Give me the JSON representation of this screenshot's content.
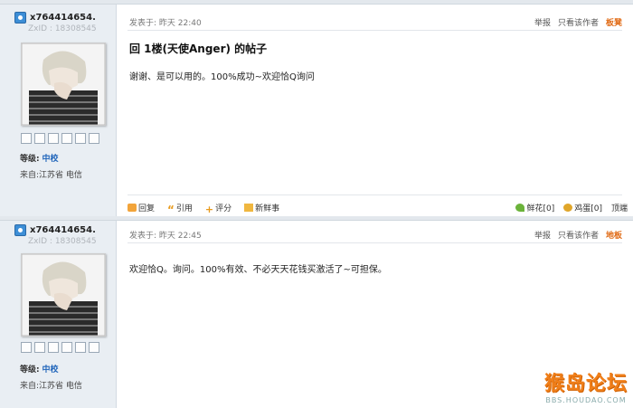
{
  "posts": [
    {
      "username": "x764414654.",
      "zxid": "ZxID : 18308545",
      "level_label": "等级:",
      "level_value": "中校",
      "from": "来自:江苏省 电信",
      "posted": "发表于: 昨天 22:40",
      "report": "举报",
      "only_author": "只看该作者",
      "floor": "板凳",
      "title": "回 1楼(天使Anger) 的帖子",
      "body": "谢谢、是可以用的。100%成功~欢迎恰Q询问",
      "actions": {
        "reply": "回复",
        "quote": "引用",
        "rate": "评分",
        "fresh": "新鲜事"
      },
      "flower": "鲜花[0]",
      "egg": "鸡蛋[0]",
      "top": "顶端"
    },
    {
      "username": "x764414654.",
      "zxid": "ZxID : 18308545",
      "level_label": "等级:",
      "level_value": "中校",
      "from": "来自:江苏省 电信",
      "posted": "发表于: 昨天 22:45",
      "report": "举报",
      "only_author": "只看该作者",
      "floor": "地板",
      "body": "欢迎恰Q。询问。100%有效、不必天天花钱买激活了~可担保。"
    }
  ],
  "watermark": {
    "name": "猴岛论坛",
    "url": "BBS.HOUDAO.COM"
  },
  "colors": {
    "sidebar": "#e9eef3",
    "accent": "#e06a14",
    "level": "#2266bb"
  }
}
